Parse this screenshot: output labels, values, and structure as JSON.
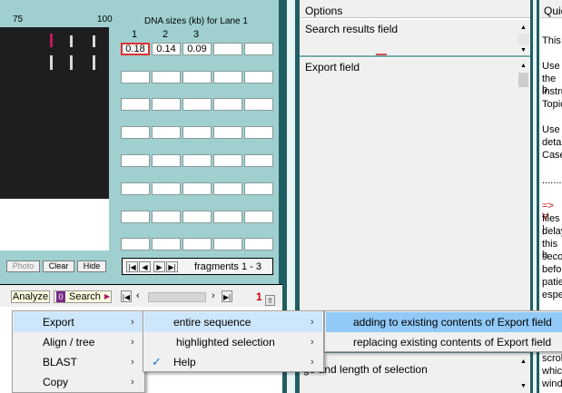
{
  "gel": {
    "ruler": {
      "ticks": [
        "75",
        "100"
      ]
    },
    "sizes_title": "DNA sizes (kb) for Lane 1",
    "column_numbers": [
      "1",
      "2",
      "3"
    ],
    "size_values": [
      "0.18",
      "0.14",
      "0.09"
    ],
    "buttons": {
      "photo": "Photo",
      "clear": "Clear",
      "hide": "Hide"
    },
    "fragments_label": "fragments 1 - 3"
  },
  "toolbar": {
    "analyze": "Analyze",
    "search_badge": "0",
    "search": "Search",
    "page_number": "1"
  },
  "options": {
    "header": "Options",
    "search_results_field": "Search results field",
    "export_field": "Export field",
    "selection_text": "ge and length of selection"
  },
  "quick": {
    "header": "Quic",
    "lines": [
      "This",
      "Use",
      "the b",
      "instru",
      "Topic",
      "Use",
      "detai",
      "Case",
      "........",
      "=> V",
      "files |",
      "delay",
      "this h",
      "seco",
      "befor",
      "patie",
      "espe",
      "scrol",
      "which",
      "wind"
    ]
  },
  "context_menu": {
    "items": [
      "Export",
      "Align / tree",
      "BLAST",
      "Copy"
    ],
    "export_submenu": {
      "items": [
        "entire sequence",
        "highlighted selection",
        "Help"
      ],
      "help_checked": true
    },
    "entire_submenu": {
      "items": [
        "adding to existing contents of Export field",
        "replacing existing contents of Export field"
      ]
    }
  },
  "colors": {
    "teal_panel": "#9fd0cf",
    "dark_teal": "#1f5f63",
    "highlight": "#91c9f7",
    "red_box": "#e03030",
    "magenta_band": "#c2185b"
  }
}
